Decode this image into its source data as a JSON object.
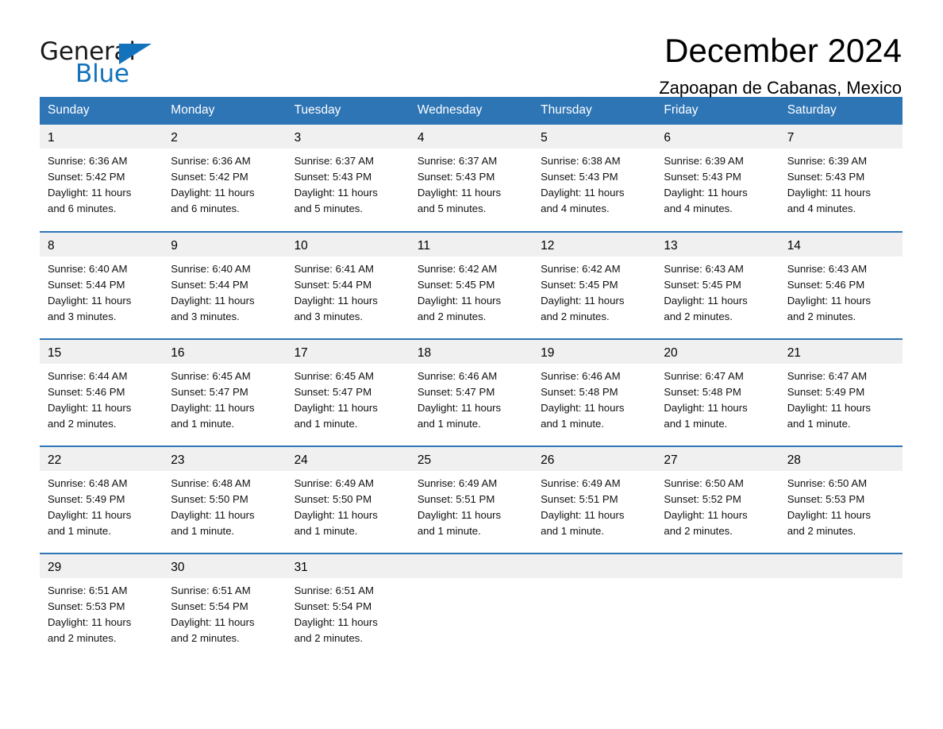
{
  "brand": {
    "name_part1": "General",
    "name_part2": "Blue",
    "accent_color": "#1272bc"
  },
  "header": {
    "month_title": "December 2024",
    "location": "Zapoapan de Cabanas, Mexico"
  },
  "calendar": {
    "header_color": "#2e75b6",
    "daynum_bg": "#f0f0f0",
    "weekdays": [
      "Sunday",
      "Monday",
      "Tuesday",
      "Wednesday",
      "Thursday",
      "Friday",
      "Saturday"
    ],
    "weeks": [
      [
        {
          "day": "1",
          "sunrise": "Sunrise: 6:36 AM",
          "sunset": "Sunset: 5:42 PM",
          "daylight_l1": "Daylight: 11 hours",
          "daylight_l2": "and 6 minutes."
        },
        {
          "day": "2",
          "sunrise": "Sunrise: 6:36 AM",
          "sunset": "Sunset: 5:42 PM",
          "daylight_l1": "Daylight: 11 hours",
          "daylight_l2": "and 6 minutes."
        },
        {
          "day": "3",
          "sunrise": "Sunrise: 6:37 AM",
          "sunset": "Sunset: 5:43 PM",
          "daylight_l1": "Daylight: 11 hours",
          "daylight_l2": "and 5 minutes."
        },
        {
          "day": "4",
          "sunrise": "Sunrise: 6:37 AM",
          "sunset": "Sunset: 5:43 PM",
          "daylight_l1": "Daylight: 11 hours",
          "daylight_l2": "and 5 minutes."
        },
        {
          "day": "5",
          "sunrise": "Sunrise: 6:38 AM",
          "sunset": "Sunset: 5:43 PM",
          "daylight_l1": "Daylight: 11 hours",
          "daylight_l2": "and 4 minutes."
        },
        {
          "day": "6",
          "sunrise": "Sunrise: 6:39 AM",
          "sunset": "Sunset: 5:43 PM",
          "daylight_l1": "Daylight: 11 hours",
          "daylight_l2": "and 4 minutes."
        },
        {
          "day": "7",
          "sunrise": "Sunrise: 6:39 AM",
          "sunset": "Sunset: 5:43 PM",
          "daylight_l1": "Daylight: 11 hours",
          "daylight_l2": "and 4 minutes."
        }
      ],
      [
        {
          "day": "8",
          "sunrise": "Sunrise: 6:40 AM",
          "sunset": "Sunset: 5:44 PM",
          "daylight_l1": "Daylight: 11 hours",
          "daylight_l2": "and 3 minutes."
        },
        {
          "day": "9",
          "sunrise": "Sunrise: 6:40 AM",
          "sunset": "Sunset: 5:44 PM",
          "daylight_l1": "Daylight: 11 hours",
          "daylight_l2": "and 3 minutes."
        },
        {
          "day": "10",
          "sunrise": "Sunrise: 6:41 AM",
          "sunset": "Sunset: 5:44 PM",
          "daylight_l1": "Daylight: 11 hours",
          "daylight_l2": "and 3 minutes."
        },
        {
          "day": "11",
          "sunrise": "Sunrise: 6:42 AM",
          "sunset": "Sunset: 5:45 PM",
          "daylight_l1": "Daylight: 11 hours",
          "daylight_l2": "and 2 minutes."
        },
        {
          "day": "12",
          "sunrise": "Sunrise: 6:42 AM",
          "sunset": "Sunset: 5:45 PM",
          "daylight_l1": "Daylight: 11 hours",
          "daylight_l2": "and 2 minutes."
        },
        {
          "day": "13",
          "sunrise": "Sunrise: 6:43 AM",
          "sunset": "Sunset: 5:45 PM",
          "daylight_l1": "Daylight: 11 hours",
          "daylight_l2": "and 2 minutes."
        },
        {
          "day": "14",
          "sunrise": "Sunrise: 6:43 AM",
          "sunset": "Sunset: 5:46 PM",
          "daylight_l1": "Daylight: 11 hours",
          "daylight_l2": "and 2 minutes."
        }
      ],
      [
        {
          "day": "15",
          "sunrise": "Sunrise: 6:44 AM",
          "sunset": "Sunset: 5:46 PM",
          "daylight_l1": "Daylight: 11 hours",
          "daylight_l2": "and 2 minutes."
        },
        {
          "day": "16",
          "sunrise": "Sunrise: 6:45 AM",
          "sunset": "Sunset: 5:47 PM",
          "daylight_l1": "Daylight: 11 hours",
          "daylight_l2": "and 1 minute."
        },
        {
          "day": "17",
          "sunrise": "Sunrise: 6:45 AM",
          "sunset": "Sunset: 5:47 PM",
          "daylight_l1": "Daylight: 11 hours",
          "daylight_l2": "and 1 minute."
        },
        {
          "day": "18",
          "sunrise": "Sunrise: 6:46 AM",
          "sunset": "Sunset: 5:47 PM",
          "daylight_l1": "Daylight: 11 hours",
          "daylight_l2": "and 1 minute."
        },
        {
          "day": "19",
          "sunrise": "Sunrise: 6:46 AM",
          "sunset": "Sunset: 5:48 PM",
          "daylight_l1": "Daylight: 11 hours",
          "daylight_l2": "and 1 minute."
        },
        {
          "day": "20",
          "sunrise": "Sunrise: 6:47 AM",
          "sunset": "Sunset: 5:48 PM",
          "daylight_l1": "Daylight: 11 hours",
          "daylight_l2": "and 1 minute."
        },
        {
          "day": "21",
          "sunrise": "Sunrise: 6:47 AM",
          "sunset": "Sunset: 5:49 PM",
          "daylight_l1": "Daylight: 11 hours",
          "daylight_l2": "and 1 minute."
        }
      ],
      [
        {
          "day": "22",
          "sunrise": "Sunrise: 6:48 AM",
          "sunset": "Sunset: 5:49 PM",
          "daylight_l1": "Daylight: 11 hours",
          "daylight_l2": "and 1 minute."
        },
        {
          "day": "23",
          "sunrise": "Sunrise: 6:48 AM",
          "sunset": "Sunset: 5:50 PM",
          "daylight_l1": "Daylight: 11 hours",
          "daylight_l2": "and 1 minute."
        },
        {
          "day": "24",
          "sunrise": "Sunrise: 6:49 AM",
          "sunset": "Sunset: 5:50 PM",
          "daylight_l1": "Daylight: 11 hours",
          "daylight_l2": "and 1 minute."
        },
        {
          "day": "25",
          "sunrise": "Sunrise: 6:49 AM",
          "sunset": "Sunset: 5:51 PM",
          "daylight_l1": "Daylight: 11 hours",
          "daylight_l2": "and 1 minute."
        },
        {
          "day": "26",
          "sunrise": "Sunrise: 6:49 AM",
          "sunset": "Sunset: 5:51 PM",
          "daylight_l1": "Daylight: 11 hours",
          "daylight_l2": "and 1 minute."
        },
        {
          "day": "27",
          "sunrise": "Sunrise: 6:50 AM",
          "sunset": "Sunset: 5:52 PM",
          "daylight_l1": "Daylight: 11 hours",
          "daylight_l2": "and 2 minutes."
        },
        {
          "day": "28",
          "sunrise": "Sunrise: 6:50 AM",
          "sunset": "Sunset: 5:53 PM",
          "daylight_l1": "Daylight: 11 hours",
          "daylight_l2": "and 2 minutes."
        }
      ],
      [
        {
          "day": "29",
          "sunrise": "Sunrise: 6:51 AM",
          "sunset": "Sunset: 5:53 PM",
          "daylight_l1": "Daylight: 11 hours",
          "daylight_l2": "and 2 minutes."
        },
        {
          "day": "30",
          "sunrise": "Sunrise: 6:51 AM",
          "sunset": "Sunset: 5:54 PM",
          "daylight_l1": "Daylight: 11 hours",
          "daylight_l2": "and 2 minutes."
        },
        {
          "day": "31",
          "sunrise": "Sunrise: 6:51 AM",
          "sunset": "Sunset: 5:54 PM",
          "daylight_l1": "Daylight: 11 hours",
          "daylight_l2": "and 2 minutes."
        },
        {
          "day": "",
          "sunrise": "",
          "sunset": "",
          "daylight_l1": "",
          "daylight_l2": ""
        },
        {
          "day": "",
          "sunrise": "",
          "sunset": "",
          "daylight_l1": "",
          "daylight_l2": ""
        },
        {
          "day": "",
          "sunrise": "",
          "sunset": "",
          "daylight_l1": "",
          "daylight_l2": ""
        },
        {
          "day": "",
          "sunrise": "",
          "sunset": "",
          "daylight_l1": "",
          "daylight_l2": ""
        }
      ]
    ]
  }
}
